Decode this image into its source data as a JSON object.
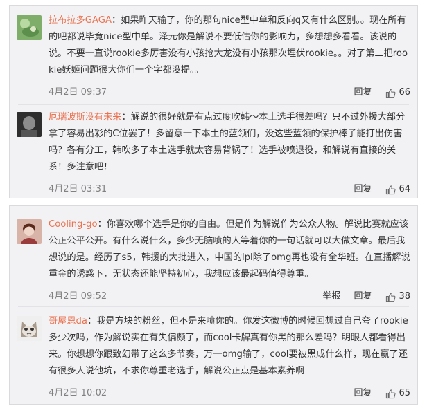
{
  "comments_top": [
    {
      "username": "拉布拉多GAGA",
      "text": "：如果昨天输了，你的那句nice型中单和反向q又有什么区别。。现在所有的吧都说毕竟nice型中单。泽元你是解说不要低估你的影响力，多想想多看看。该说的说。不要一直说rookie多厉害没有小孩抢大龙没有小孩那次埋伏rookie。。对了第二把rookie妖姬问题很大你们一个字都没提。。",
      "date": "4月2日 09:37",
      "reply": "回复",
      "likes": "66"
    },
    {
      "username": "厄瑞波斯没有未来",
      "text": "：解说的很好就是有点过度吹韩～本土选手很差吗？只不过外援大部分拿了容易出彩的C位罢了！多留意一下本土的蓝领们，没这些蓝领的保护棒子能打出伤害吗？各有分工，韩吹多了本土选手就太容易背锅了！选手被喷退役，和解说有直接的关系！多注意吧！",
      "date": "4月2日 03:31",
      "reply": "回复",
      "likes": "64"
    }
  ],
  "comments_bottom": [
    {
      "username": "Cooling-go",
      "text": "：你喜欢哪个选手是你的自由。但是作为解说作为公众人物。解说比赛就应该公正公平公开。有什么说什么，多少无脑喷的人等着你的一句话就可以大做文章。最后我想说的是。经历了s5，韩援的大批进入，中国的lpl除了omg再也没有全华班。在直播解说重金的诱惑下，无状态还能坚持初心，我想应该最起码值得尊重。",
      "date": "4月2日 09:52",
      "report": "举报",
      "reply": "回复",
      "likes": "38"
    },
    {
      "username": "哥屋恩da",
      "text": "：我是方块的粉丝，但不是来喷你的。你发这微博的时候回想过自己夸了rookie多少次吗，作为解说实在有失偏颇了，而cool卡牌真有你黑的那么差吗？明眼人都看得出来。你想想你跟致幻带了这么多节奏，万一omg输了，cool要被黑成什么样，现在赢了还有很多人说他坑，不求你尊重老选手，解说公正点是基本素养啊",
      "date": "4月2日 10:02",
      "reply": "回复",
      "likes": "65"
    }
  ],
  "colors": {
    "username": "#eb7350",
    "panel_bg": "#f2f2f5",
    "date": "#808080"
  },
  "icons": {
    "like": "thumbs-up-icon"
  }
}
